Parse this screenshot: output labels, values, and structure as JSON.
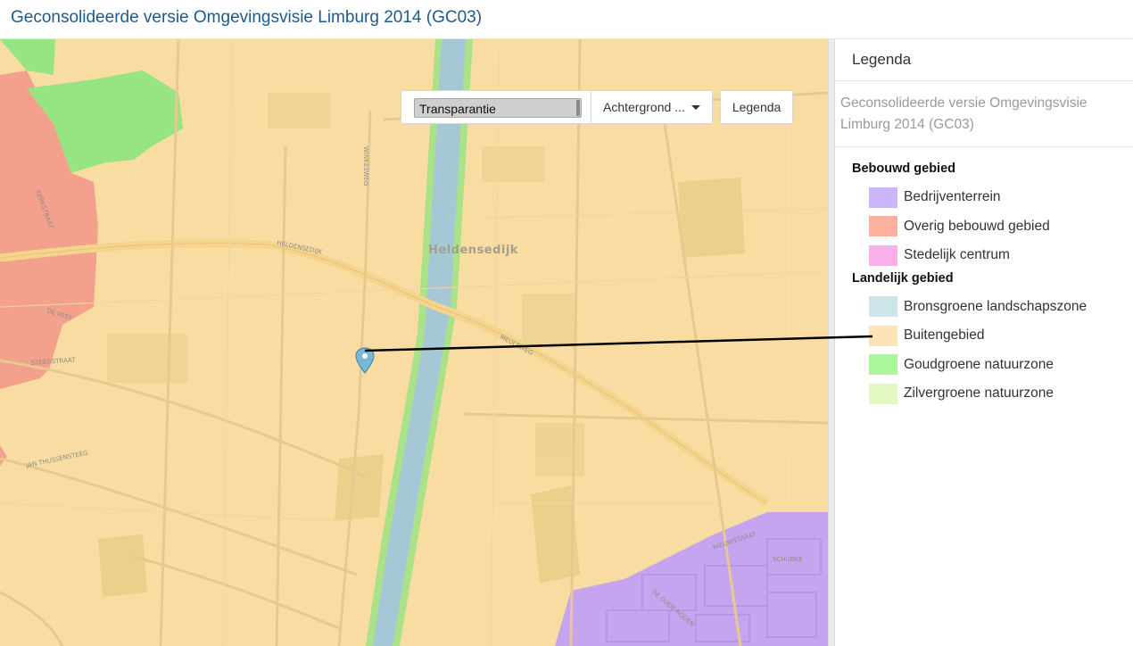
{
  "page": {
    "title": "Geconsolideerde versie Omgevingsvisie Limburg 2014 (GC03)"
  },
  "map_controls": {
    "transparency_label": "Transparantie",
    "background_label": "Achtergrond ...",
    "legend_button_label": "Legenda"
  },
  "map": {
    "place_labels": [
      "Heldensedijk"
    ],
    "street_labels": [
      "HELDENSEDIJK",
      "STEEGSTRAAT",
      "JAN THUSSENSTEEG",
      "MEULEWEG",
      "WINKESWEG",
      "DE PAST",
      "SCHUBKE",
      "NIEUWSTRAAT",
      "KERKSTRAAT",
      "DE OUDE RODEN"
    ],
    "colors": {
      "buitengebied": "#f8dca2",
      "bebouwd": "#f3a08c",
      "bedrijventerrein": "#c5a5f0",
      "goudgroen": "#96e482",
      "kanaal": "#a6c8d6"
    }
  },
  "legend": {
    "header": "Legenda",
    "subtitle": "Geconsolideerde versie Omgevingsvisie Limburg 2014 (GC03)",
    "groups": [
      {
        "title": "Bebouwd gebied",
        "items": [
          {
            "label": "Bedrijventerrein",
            "color": "#cdb5f9"
          },
          {
            "label": "Overig bebouwd gebied",
            "color": "#fdb09d"
          },
          {
            "label": "Stedelijk centrum",
            "color": "#fbb0ec"
          }
        ]
      },
      {
        "title": "Landelijk gebied",
        "items": [
          {
            "label": "Bronsgroene landschapszone",
            "color": "#cde5e8"
          },
          {
            "label": "Buitengebied",
            "color": "#fde3b5"
          },
          {
            "label": "Goudgroene natuurzone",
            "color": "#adf79b"
          },
          {
            "label": "Zilvergroene natuurzone",
            "color": "#e4f9c2"
          }
        ]
      }
    ]
  }
}
